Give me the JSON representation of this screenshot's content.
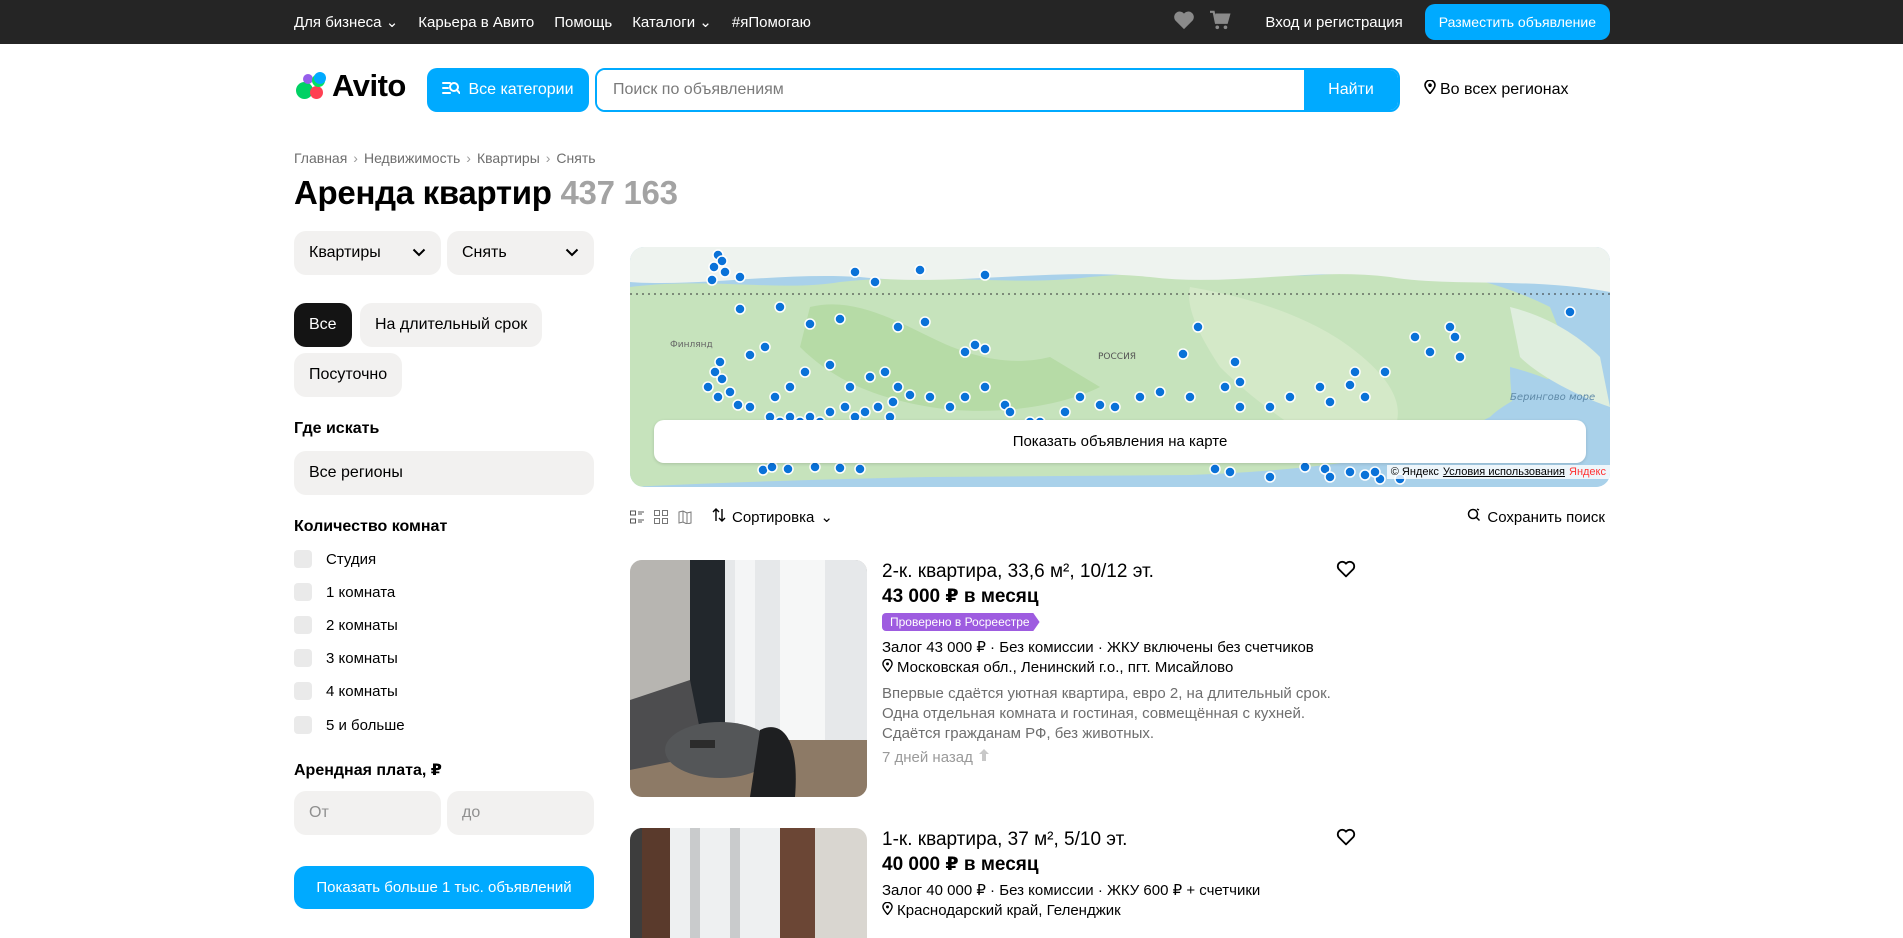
{
  "topbar": {
    "nav": [
      {
        "label": "Для бизнеса",
        "dropdown": true
      },
      {
        "label": "Карьера в Авито",
        "dropdown": false
      },
      {
        "label": "Помощь",
        "dropdown": false
      },
      {
        "label": "Каталоги",
        "dropdown": true
      },
      {
        "label": "#яПомогаю",
        "dropdown": false
      }
    ],
    "login_label": "Вход и регистрация",
    "post_label": "Разместить объявление",
    "icons": [
      "heart-icon",
      "cart-icon"
    ]
  },
  "header": {
    "logo_text": "Avito",
    "categories_label": "Все категории",
    "search_placeholder": "Поиск по объявлениям",
    "search_button": "Найти",
    "region_label": "Во всех регионах"
  },
  "breadcrumbs": [
    "Главная",
    "Недвижимость",
    "Квартиры",
    "Снять"
  ],
  "page": {
    "title": "Аренда квартир",
    "count": "437 163"
  },
  "filters": {
    "type_select": "Квартиры",
    "deal_select": "Снять",
    "term_chips": [
      {
        "label": "Все",
        "active": true
      },
      {
        "label": "На длительный срок",
        "active": false
      },
      {
        "label": "Посуточно",
        "active": false
      }
    ],
    "where_title": "Где искать",
    "where_value": "Все регионы",
    "rooms_title": "Количество комнат",
    "rooms": [
      "Студия",
      "1 комната",
      "2 комнаты",
      "3 комнаты",
      "4 комнаты",
      "5 и больше"
    ],
    "price_title": "Арендная плата, ₽",
    "price_from_placeholder": "От",
    "price_to_placeholder": "до",
    "show_more_label": "Показать больше 1 тыс. объявлений"
  },
  "map": {
    "button_label": "Показать объявления на карте",
    "credit_copy": "© Яндекс",
    "credit_terms": "Условия использования",
    "credit_brand": "Яндекс",
    "labels": [
      "Финлянд",
      "РОССИЯ",
      "Берингово море"
    ]
  },
  "toolbar": {
    "sort_label": "Сортировка",
    "save_label": "Сохранить поиск"
  },
  "listings": [
    {
      "title": "2-к. квартира, 33,6 м², 10/12 эт.",
      "price": "43 000 ₽ в месяц",
      "badge": "Проверено в Росреестре",
      "params": "Залог 43 000 ₽ · Без комиссии · ЖКУ включены без счетчиков",
      "address": "Московская обл., Ленинский г.о., пгт. Мисайлово",
      "description": "Впервые сдаётся уютная квартира, евро 2, на длительный срок. Одна отдельная комната и гостиная, совмещённая с кухней. Сдаётся гражданам РФ, без животных.",
      "date": "7 дней назад"
    },
    {
      "title": "1-к. квартира, 37 м², 5/10 эт.",
      "price": "40 000 ₽ в месяц",
      "params": "Залог 40 000 ₽ · Без комиссии · ЖКУ 600 ₽ + счетчики",
      "address": "Краснодарский край, Геленджик"
    }
  ],
  "colors": {
    "accent": "#00aaff",
    "topbar": "#252525",
    "badge": "#9e5ce0",
    "map_dot": "#0a72d8"
  }
}
